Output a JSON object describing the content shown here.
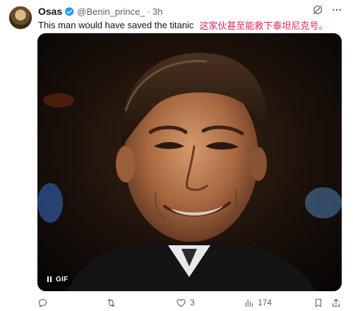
{
  "tweet": {
    "author_name": "Osas",
    "handle": "@Benin_prince_",
    "separator": "·",
    "time": "3h",
    "text": "This man would have saved the titanic",
    "translation": "这家伙甚至能救下泰坦尼克号。",
    "media": {
      "badge": "GIF",
      "type": "animated-gif"
    },
    "actions": {
      "reply": {
        "icon": "reply-icon",
        "count": ""
      },
      "retweet": {
        "icon": "retweet-icon",
        "count": ""
      },
      "like": {
        "icon": "heart-icon",
        "count": "3"
      },
      "views": {
        "icon": "views-icon",
        "count": "174"
      },
      "bookmark": {
        "icon": "bookmark-icon",
        "count": ""
      },
      "share": {
        "icon": "share-icon",
        "count": ""
      }
    },
    "header_icons": [
      "grok-icon",
      "more-icon"
    ]
  },
  "colors": {
    "text_primary": "#0f1419",
    "text_secondary": "#536471",
    "verified_blue": "#1d9bf0",
    "translation_red": "#e0245e"
  }
}
